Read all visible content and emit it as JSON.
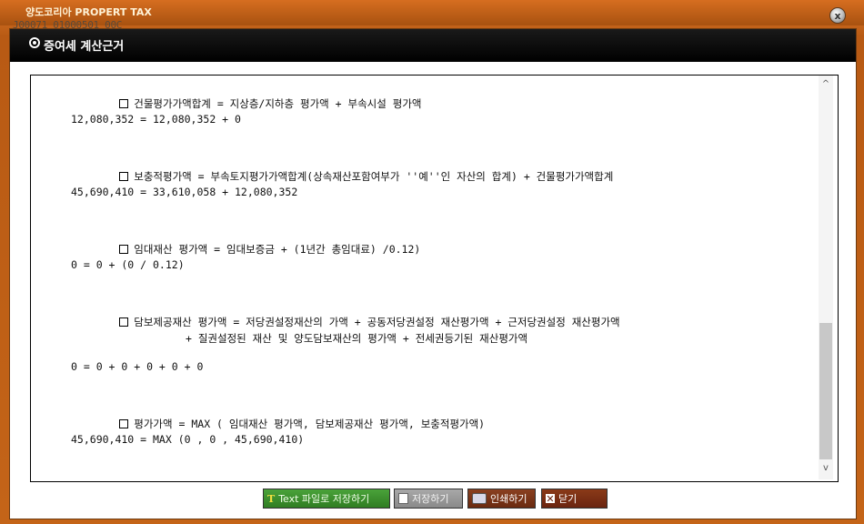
{
  "window": {
    "title": "양도코리아 PROPERT TAX",
    "screen_id": "J00071_01000501_00C",
    "close_symbol": "x"
  },
  "dialog": {
    "title": "증여세 계산근거"
  },
  "content": {
    "sections": [
      {
        "heading": "건물평가가액합계 = 지상층/지하층 평가액 + 부속시설 평가액",
        "calculation": "12,080,352 = 12,080,352 + 0"
      },
      {
        "heading": "보충적평가액 = 부속토지평가가액합계(상속재산포함여부가 ''예''인 자산의 합계) + 건물평가가액합계",
        "calculation": "45,690,410 = 33,610,058 + 12,080,352"
      },
      {
        "heading": "임대재산 평가액 = 임대보증금 + (1년간 총임대료) /0.12)",
        "calculation": "0 = 0 + (0 / 0.12)"
      },
      {
        "heading": "담보제공재산 평가액 = 저당권설정재산의 가액 + 공동저당권설정 재산평가액 + 근저당권설정 재산평가액",
        "continuation": "+ 질권설정된 재산 및 양도담보재산의 평가액 + 전세권등기된 재산평가액",
        "calculation": "0 = 0 + 0 + 0 + 0 + 0"
      },
      {
        "heading": "평가가액 = MAX ( 임대재산 평가액, 담보제공재산 평가액, 보충적평가액)",
        "calculation": "45,690,410 = MAX (0 , 0 , 45,690,410)"
      }
    ]
  },
  "scrollbar": {
    "up_arrow": "^",
    "down_arrow": "v"
  },
  "buttons": {
    "save_text_label": "Text 파일로 저장하기",
    "save_label": "저장하기",
    "print_label": "인쇄하기",
    "close_label": "닫기"
  },
  "colors": {
    "frame": "#c8641a",
    "header": "#000000",
    "text_button": "#3a8f2c",
    "save_button": "#9a9a9a",
    "print_button": "#7a3418",
    "close_button": "#7a3015"
  }
}
